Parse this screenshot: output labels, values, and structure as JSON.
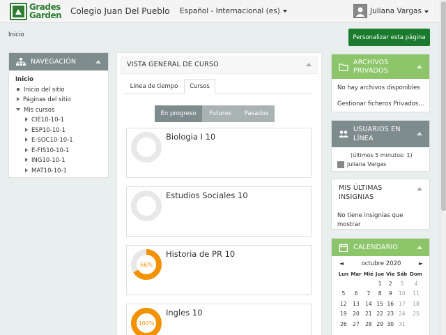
{
  "header": {
    "logo_line1": "Grades",
    "logo_line2": "Garden",
    "site_name": "Colegio Juan Del Pueblo",
    "language": "Español - Internacional (es)",
    "user_name": "Juliana Vargas"
  },
  "breadcrumb": "Inicio",
  "customize_button": "Personalizar esta página",
  "navigation": {
    "title": "NAVEGACIÓN",
    "home": "Inicio",
    "site_home": "Inicio del sitio",
    "site_pages": "Páginas del sitio",
    "my_courses": "Mis cursos",
    "courses": [
      "CIE10-10-1",
      "ESP10-10-1",
      "E-SOC10-10-1",
      "E-FIS10-10-1",
      "ING10-10-1",
      "MAT10-10-1"
    ]
  },
  "overview": {
    "title": "VISTA GENERAL DE CURSO",
    "tabs": [
      "Línea de tiempo",
      "Cursos"
    ],
    "filters": [
      "En progreso",
      "Futuros",
      "Pasados"
    ],
    "courses": [
      {
        "name": "Biologia I 10",
        "progress": 0,
        "label": "0%"
      },
      {
        "name": "Estudios Sociales 10",
        "progress": 0,
        "label": "0%"
      },
      {
        "name": "Historia de PR 10",
        "progress": 66,
        "label": "66%"
      },
      {
        "name": "Ingles 10",
        "progress": 100,
        "label": "100%"
      }
    ]
  },
  "private_files": {
    "title_line1": "ARCHIVOS",
    "title_line2": "PRIVADOS",
    "empty": "No hay archivos disponibles",
    "manage": "Gestionar ficheros Privados..."
  },
  "online_users": {
    "title_line1": "USUARIOS EN",
    "title_line2": "LÍNEA",
    "period": "(últimos 5 minutos: 1)",
    "user": "Juliana Vargas"
  },
  "badges": {
    "title_line1": "MIS ÚLTIMAS",
    "title_line2": "INSIGNIAS",
    "empty_line1": "No tiene insignias que",
    "empty_line2": "mostrar"
  },
  "calendar": {
    "title": "CALENDARIO",
    "month": "octubre 2020",
    "prev": "◄",
    "next": "►",
    "weekdays": [
      "Lun",
      "Mar",
      "Mié",
      "Jue",
      "Vie",
      "Sáb",
      "Dom"
    ],
    "weeks": [
      [
        "",
        "",
        "",
        "1",
        "2",
        "3",
        "4"
      ],
      [
        "5",
        "6",
        "7",
        "8",
        "9",
        "10",
        "11"
      ],
      [
        "12",
        "13",
        "14",
        "15",
        "16",
        "17",
        "18"
      ],
      [
        "19",
        "20",
        "21",
        "22",
        "23",
        "24",
        "25"
      ],
      [
        "26",
        "27",
        "28",
        "29",
        "30",
        "31",
        ""
      ]
    ]
  },
  "colors": {
    "brand_green": "#1a7a2e",
    "block_green": "#8cc56a",
    "block_gray": "#7f8c8d",
    "progress_orange": "#f39200"
  }
}
